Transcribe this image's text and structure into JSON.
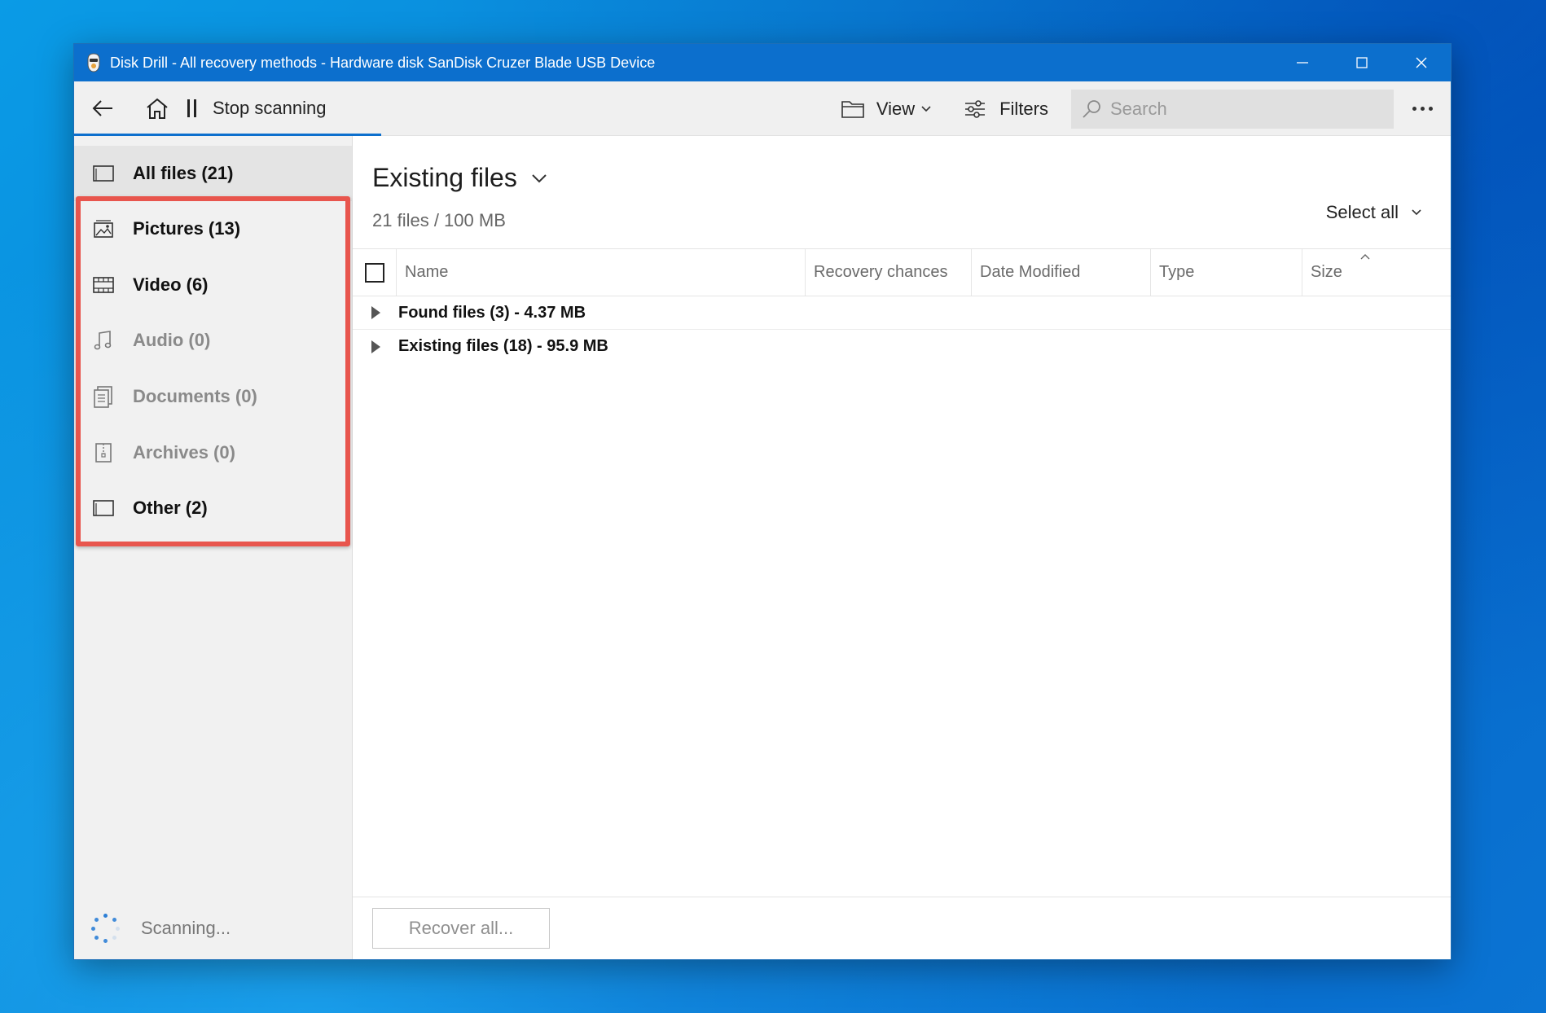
{
  "window": {
    "title": "Disk Drill - All recovery methods - Hardware disk SanDisk Cruzer Blade USB Device"
  },
  "toolbar": {
    "stop_label": "Stop scanning",
    "view_label": "View",
    "filters_label": "Filters",
    "search_placeholder": "Search"
  },
  "sidebar": {
    "all_files": "All files (21)",
    "categories": [
      {
        "label": "Pictures (13)",
        "icon": "picture-icon",
        "enabled": true
      },
      {
        "label": "Video (6)",
        "icon": "film-icon",
        "enabled": true
      },
      {
        "label": "Audio (0)",
        "icon": "music-note-icon",
        "enabled": false
      },
      {
        "label": "Documents (0)",
        "icon": "document-icon",
        "enabled": false
      },
      {
        "label": "Archives (0)",
        "icon": "archive-icon",
        "enabled": false
      },
      {
        "label": "Other (2)",
        "icon": "other-file-icon",
        "enabled": true
      }
    ],
    "status": "Scanning..."
  },
  "main": {
    "title": "Existing files",
    "summary": "21 files / 100 MB",
    "select_all": "Select all",
    "columns": [
      "Name",
      "Recovery chances",
      "Date Modified",
      "Type",
      "Size"
    ],
    "rows": [
      {
        "label": "Found files (3) - 4.37 MB"
      },
      {
        "label": "Existing files (18) - 95.9 MB"
      }
    ],
    "recover_label": "Recover all..."
  },
  "colors": {
    "titlebar": "#0c6fcd",
    "highlight": "#e8554d",
    "accent": "#0c6fcd"
  }
}
